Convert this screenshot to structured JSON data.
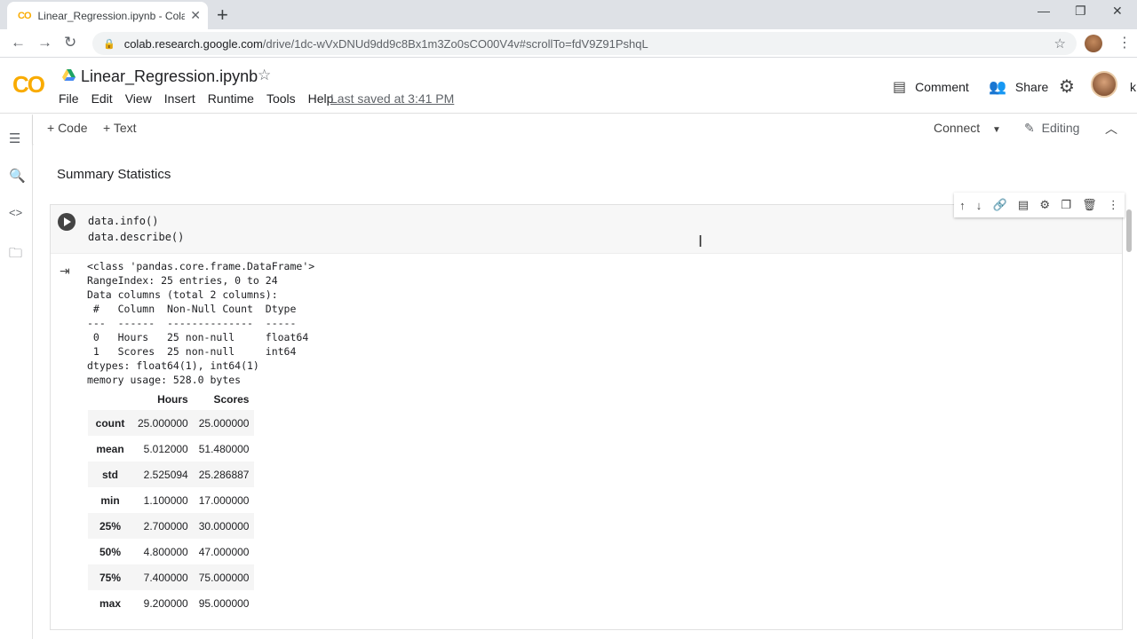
{
  "browser": {
    "tab_title": "Linear_Regression.ipynb - Colabc",
    "tab_favicon": "CO",
    "url_host": "colab.research.google.com",
    "url_path": "/drive/1dc-wVxDNUd9dd9c8Bx1m3Zo0sCO00V4v#scrollTo=fdV9Z91PshqL"
  },
  "colab": {
    "logo": "CO",
    "notebook_title": "Linear_Regression.ipynb",
    "menus": [
      "File",
      "Edit",
      "View",
      "Insert",
      "Runtime",
      "Tools",
      "Help"
    ],
    "last_saved": "Last saved at 3:41 PM",
    "comment_label": "Comment",
    "share_label": "Share",
    "k_letter": "k"
  },
  "toolbar": {
    "code_label": "+ Code",
    "text_label": "+ Text",
    "connect_label": "Connect",
    "editing_label": "Editing"
  },
  "notebook": {
    "section_title": "Summary Statistics",
    "code_lines": "data.info()\ndata.describe()",
    "info_output": "<class 'pandas.core.frame.DataFrame'>\nRangeIndex: 25 entries, 0 to 24\nData columns (total 2 columns):\n #   Column  Non-Null Count  Dtype  \n---  ------  --------------  -----  \n 0   Hours   25 non-null     float64\n 1   Scores  25 non-null     int64  \ndtypes: float64(1), int64(1)\nmemory usage: 528.0 bytes",
    "describe": {
      "columns": [
        "",
        "Hours",
        "Scores"
      ],
      "rows": [
        {
          "label": "count",
          "hours": "25.000000",
          "scores": "25.000000"
        },
        {
          "label": "mean",
          "hours": "5.012000",
          "scores": "51.480000"
        },
        {
          "label": "std",
          "hours": "2.525094",
          "scores": "25.286887"
        },
        {
          "label": "min",
          "hours": "1.100000",
          "scores": "17.000000"
        },
        {
          "label": "25%",
          "hours": "2.700000",
          "scores": "30.000000"
        },
        {
          "label": "50%",
          "hours": "4.800000",
          "scores": "47.000000"
        },
        {
          "label": "75%",
          "hours": "7.400000",
          "scores": "75.000000"
        },
        {
          "label": "max",
          "hours": "9.200000",
          "scores": "95.000000"
        }
      ]
    }
  },
  "colors": {
    "accent_colab": "#f9ab00",
    "run_button": "#444444"
  }
}
